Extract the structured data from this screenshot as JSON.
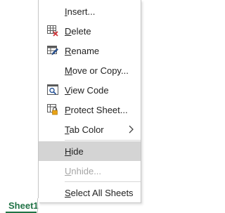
{
  "menu": {
    "items": [
      {
        "label_accel": "I",
        "label_rest": "nsert...",
        "icon": "none"
      },
      {
        "label_accel": "D",
        "label_rest": "elete",
        "icon": "delete-sheet-icon"
      },
      {
        "label_accel": "R",
        "label_rest": "ename",
        "icon": "rename-sheet-icon"
      },
      {
        "label_accel": "M",
        "label_rest": "ove or Copy...",
        "icon": "none"
      },
      {
        "label_accel": "V",
        "label_rest": "iew Code",
        "icon": "view-code-icon"
      },
      {
        "label_accel": "P",
        "label_rest": "rotect Sheet...",
        "icon": "protect-sheet-icon"
      },
      {
        "label_accel": "T",
        "label_rest": "ab Color",
        "icon": "none",
        "submenu": true
      },
      {
        "label_accel": "H",
        "label_rest": "ide",
        "icon": "none",
        "state": "highlighted"
      },
      {
        "label_accel": "U",
        "label_rest": "nhide...",
        "icon": "none",
        "state": "disabled"
      },
      {
        "label_accel": "S",
        "label_rest": "elect All Sheets",
        "icon": "none"
      }
    ]
  },
  "sheet_tab": {
    "label": "Sheet1",
    "accent_color": "#217346"
  },
  "colors": {
    "highlight": "#d4d4d4",
    "disabled_text": "#a6a6a6",
    "text": "#222222"
  }
}
